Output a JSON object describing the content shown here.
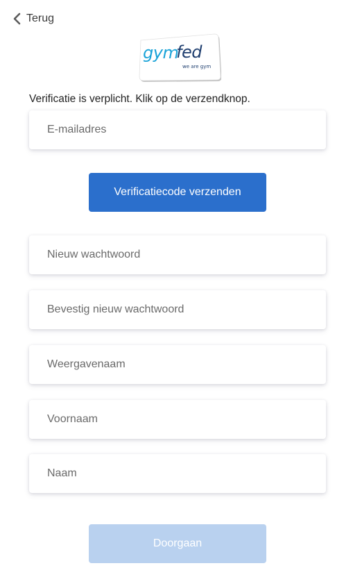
{
  "back": {
    "label": "Terug"
  },
  "logo": {
    "wordmark": "gymfed",
    "tagline": "we are gym"
  },
  "intro_text": "Verificatie is verplicht. Klik op de verzendknop.",
  "fields": {
    "email": {
      "placeholder": "E-mailadres",
      "value": ""
    },
    "new_password": {
      "placeholder": "Nieuw wachtwoord",
      "value": ""
    },
    "confirm_password": {
      "placeholder": "Bevestig nieuw wachtwoord",
      "value": ""
    },
    "display_name": {
      "placeholder": "Weergavenaam",
      "value": ""
    },
    "first_name": {
      "placeholder": "Voornaam",
      "value": ""
    },
    "last_name": {
      "placeholder": "Naam",
      "value": ""
    }
  },
  "buttons": {
    "send_code": "Verificatiecode verzenden",
    "continue": "Doorgaan"
  },
  "colors": {
    "primary": "#2b6fcc",
    "primary_disabled": "#b9d1ef",
    "logo_blue": "#1aa3d8",
    "logo_navy": "#1d3d6e"
  },
  "icons": {
    "back": "chevron-left-icon"
  }
}
